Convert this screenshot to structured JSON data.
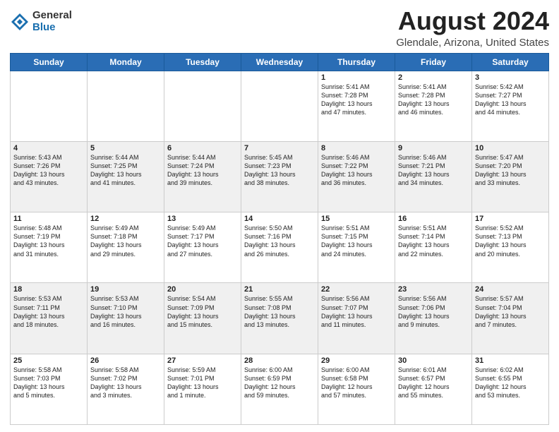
{
  "logo": {
    "general": "General",
    "blue": "Blue"
  },
  "title": "August 2024",
  "subtitle": "Glendale, Arizona, United States",
  "days_header": [
    "Sunday",
    "Monday",
    "Tuesday",
    "Wednesday",
    "Thursday",
    "Friday",
    "Saturday"
  ],
  "weeks": [
    [
      {
        "num": "",
        "info": ""
      },
      {
        "num": "",
        "info": ""
      },
      {
        "num": "",
        "info": ""
      },
      {
        "num": "",
        "info": ""
      },
      {
        "num": "1",
        "info": "Sunrise: 5:41 AM\nSunset: 7:28 PM\nDaylight: 13 hours\nand 47 minutes."
      },
      {
        "num": "2",
        "info": "Sunrise: 5:41 AM\nSunset: 7:28 PM\nDaylight: 13 hours\nand 46 minutes."
      },
      {
        "num": "3",
        "info": "Sunrise: 5:42 AM\nSunset: 7:27 PM\nDaylight: 13 hours\nand 44 minutes."
      }
    ],
    [
      {
        "num": "4",
        "info": "Sunrise: 5:43 AM\nSunset: 7:26 PM\nDaylight: 13 hours\nand 43 minutes."
      },
      {
        "num": "5",
        "info": "Sunrise: 5:44 AM\nSunset: 7:25 PM\nDaylight: 13 hours\nand 41 minutes."
      },
      {
        "num": "6",
        "info": "Sunrise: 5:44 AM\nSunset: 7:24 PM\nDaylight: 13 hours\nand 39 minutes."
      },
      {
        "num": "7",
        "info": "Sunrise: 5:45 AM\nSunset: 7:23 PM\nDaylight: 13 hours\nand 38 minutes."
      },
      {
        "num": "8",
        "info": "Sunrise: 5:46 AM\nSunset: 7:22 PM\nDaylight: 13 hours\nand 36 minutes."
      },
      {
        "num": "9",
        "info": "Sunrise: 5:46 AM\nSunset: 7:21 PM\nDaylight: 13 hours\nand 34 minutes."
      },
      {
        "num": "10",
        "info": "Sunrise: 5:47 AM\nSunset: 7:20 PM\nDaylight: 13 hours\nand 33 minutes."
      }
    ],
    [
      {
        "num": "11",
        "info": "Sunrise: 5:48 AM\nSunset: 7:19 PM\nDaylight: 13 hours\nand 31 minutes."
      },
      {
        "num": "12",
        "info": "Sunrise: 5:49 AM\nSunset: 7:18 PM\nDaylight: 13 hours\nand 29 minutes."
      },
      {
        "num": "13",
        "info": "Sunrise: 5:49 AM\nSunset: 7:17 PM\nDaylight: 13 hours\nand 27 minutes."
      },
      {
        "num": "14",
        "info": "Sunrise: 5:50 AM\nSunset: 7:16 PM\nDaylight: 13 hours\nand 26 minutes."
      },
      {
        "num": "15",
        "info": "Sunrise: 5:51 AM\nSunset: 7:15 PM\nDaylight: 13 hours\nand 24 minutes."
      },
      {
        "num": "16",
        "info": "Sunrise: 5:51 AM\nSunset: 7:14 PM\nDaylight: 13 hours\nand 22 minutes."
      },
      {
        "num": "17",
        "info": "Sunrise: 5:52 AM\nSunset: 7:13 PM\nDaylight: 13 hours\nand 20 minutes."
      }
    ],
    [
      {
        "num": "18",
        "info": "Sunrise: 5:53 AM\nSunset: 7:11 PM\nDaylight: 13 hours\nand 18 minutes."
      },
      {
        "num": "19",
        "info": "Sunrise: 5:53 AM\nSunset: 7:10 PM\nDaylight: 13 hours\nand 16 minutes."
      },
      {
        "num": "20",
        "info": "Sunrise: 5:54 AM\nSunset: 7:09 PM\nDaylight: 13 hours\nand 15 minutes."
      },
      {
        "num": "21",
        "info": "Sunrise: 5:55 AM\nSunset: 7:08 PM\nDaylight: 13 hours\nand 13 minutes."
      },
      {
        "num": "22",
        "info": "Sunrise: 5:56 AM\nSunset: 7:07 PM\nDaylight: 13 hours\nand 11 minutes."
      },
      {
        "num": "23",
        "info": "Sunrise: 5:56 AM\nSunset: 7:06 PM\nDaylight: 13 hours\nand 9 minutes."
      },
      {
        "num": "24",
        "info": "Sunrise: 5:57 AM\nSunset: 7:04 PM\nDaylight: 13 hours\nand 7 minutes."
      }
    ],
    [
      {
        "num": "25",
        "info": "Sunrise: 5:58 AM\nSunset: 7:03 PM\nDaylight: 13 hours\nand 5 minutes."
      },
      {
        "num": "26",
        "info": "Sunrise: 5:58 AM\nSunset: 7:02 PM\nDaylight: 13 hours\nand 3 minutes."
      },
      {
        "num": "27",
        "info": "Sunrise: 5:59 AM\nSunset: 7:01 PM\nDaylight: 13 hours\nand 1 minute."
      },
      {
        "num": "28",
        "info": "Sunrise: 6:00 AM\nSunset: 6:59 PM\nDaylight: 12 hours\nand 59 minutes."
      },
      {
        "num": "29",
        "info": "Sunrise: 6:00 AM\nSunset: 6:58 PM\nDaylight: 12 hours\nand 57 minutes."
      },
      {
        "num": "30",
        "info": "Sunrise: 6:01 AM\nSunset: 6:57 PM\nDaylight: 12 hours\nand 55 minutes."
      },
      {
        "num": "31",
        "info": "Sunrise: 6:02 AM\nSunset: 6:55 PM\nDaylight: 12 hours\nand 53 minutes."
      }
    ]
  ]
}
